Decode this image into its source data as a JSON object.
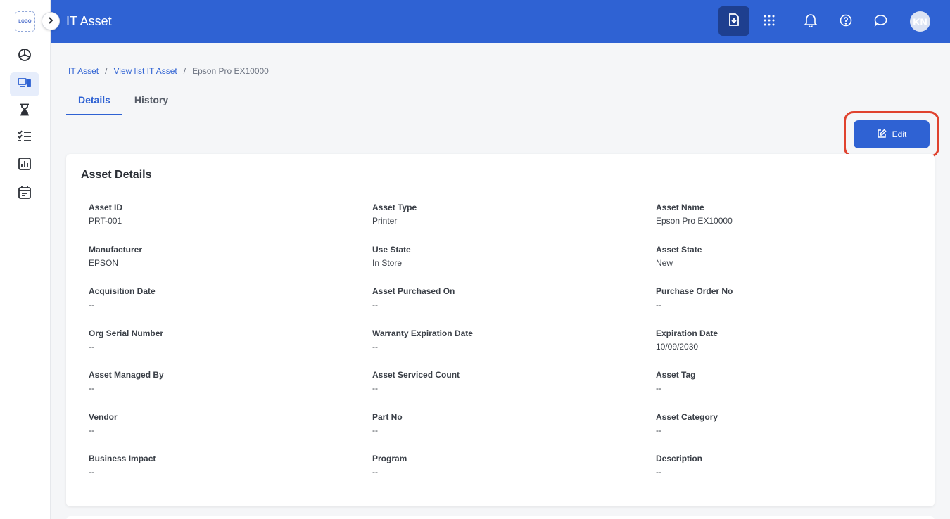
{
  "sidebar": {
    "logo_text": "LOGO",
    "items": [
      {
        "icon": "dashboard-icon"
      },
      {
        "icon": "devices-icon",
        "active": true
      },
      {
        "icon": "hourglass-icon"
      },
      {
        "icon": "checklist-icon"
      },
      {
        "icon": "report-icon"
      },
      {
        "icon": "calendar-icon"
      }
    ]
  },
  "header": {
    "title": "IT Asset",
    "avatar_initials": "KN",
    "icons": [
      "download-icon",
      "apps-grid-icon",
      "bell-icon",
      "help-icon",
      "chat-icon"
    ]
  },
  "breadcrumb": {
    "items": [
      "IT Asset",
      "View list IT Asset"
    ],
    "current": "Epson Pro EX10000",
    "separator": "/"
  },
  "tabs": [
    {
      "label": "Details",
      "active": true
    },
    {
      "label": "History",
      "active": false
    }
  ],
  "edit_button": {
    "label": "Edit"
  },
  "card": {
    "title": "Asset Details",
    "fields": [
      {
        "label": "Asset ID",
        "value": "PRT-001"
      },
      {
        "label": "Asset Type",
        "value": "Printer"
      },
      {
        "label": "Asset Name",
        "value": "Epson Pro EX10000"
      },
      {
        "label": "Manufacturer",
        "value": "EPSON"
      },
      {
        "label": "Use State",
        "value": "In Store"
      },
      {
        "label": "Asset State",
        "value": "New"
      },
      {
        "label": "Acquisition Date",
        "value": "--"
      },
      {
        "label": "Asset Purchased On",
        "value": "--"
      },
      {
        "label": "Purchase Order No",
        "value": "--"
      },
      {
        "label": "Org Serial Number",
        "value": "--"
      },
      {
        "label": "Warranty Expiration Date",
        "value": "--"
      },
      {
        "label": "Expiration Date",
        "value": "10/09/2030"
      },
      {
        "label": "Asset Managed By",
        "value": "--"
      },
      {
        "label": "Asset Serviced Count",
        "value": "--"
      },
      {
        "label": "Asset Tag",
        "value": "--"
      },
      {
        "label": "Vendor",
        "value": "--"
      },
      {
        "label": "Part No",
        "value": "--"
      },
      {
        "label": "Asset Category",
        "value": "--"
      },
      {
        "label": "Business Impact",
        "value": "--"
      },
      {
        "label": "Program",
        "value": "--"
      },
      {
        "label": "Description",
        "value": "--"
      }
    ]
  },
  "colors": {
    "primary": "#2f62d3",
    "header_accent": "#1e3f8f",
    "highlight": "#e0432f"
  }
}
